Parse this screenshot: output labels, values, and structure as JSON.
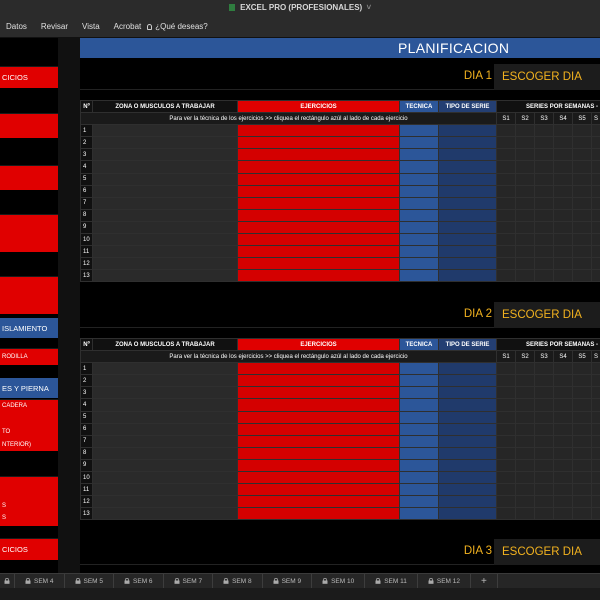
{
  "window": {
    "title": "EXCEL PRO (PROFESIONALES)",
    "chevron": "˅"
  },
  "menu": [
    "Datos",
    "Revisar",
    "Vista",
    "Acrobat",
    "¿Qué deseas?"
  ],
  "left": {
    "sections": [
      {
        "label": "CICIOS",
        "top": 28
      },
      {
        "label": "ISLAMIENTO",
        "top": 280
      },
      {
        "label": "ES Y PIERNA",
        "top": 340
      },
      {
        "label": "CICIOS",
        "top": 500
      }
    ],
    "items": [
      "RODILLA",
      "CADERA",
      "TO",
      "NTERIOR)",
      "S",
      "S"
    ]
  },
  "main": {
    "title": "PLANIFICACION",
    "pick": "ESCOGER DIA",
    "days": [
      "DIA 1",
      "DIA 2",
      "DIA 3"
    ],
    "headers": {
      "num": "Nº",
      "zona": "ZONA O MUSCULOS A TRABAJAR",
      "ejercicios": "EJERCICIOS",
      "tecnica": "TECNICA",
      "tipo": "TIPO DE SERIE",
      "series": "SERIES POR SEMANAS -"
    },
    "note": "Para ver la técnica de los ejercicios >> cliquea el rectángulo azúl al lado de cada ejercicio",
    "weeks": [
      "S1",
      "S2",
      "S3",
      "S4",
      "S5",
      "S"
    ],
    "rows": [
      "1",
      "2",
      "3",
      "4",
      "5",
      "6",
      "7",
      "8",
      "9",
      "10",
      "11",
      "12",
      "13"
    ]
  },
  "tabs": [
    "SEM 4",
    "SEM 5",
    "SEM 6",
    "SEM 7",
    "SEM 8",
    "SEM 9",
    "SEM 10",
    "SEM 11",
    "SEM 12"
  ],
  "tab_add": "+"
}
